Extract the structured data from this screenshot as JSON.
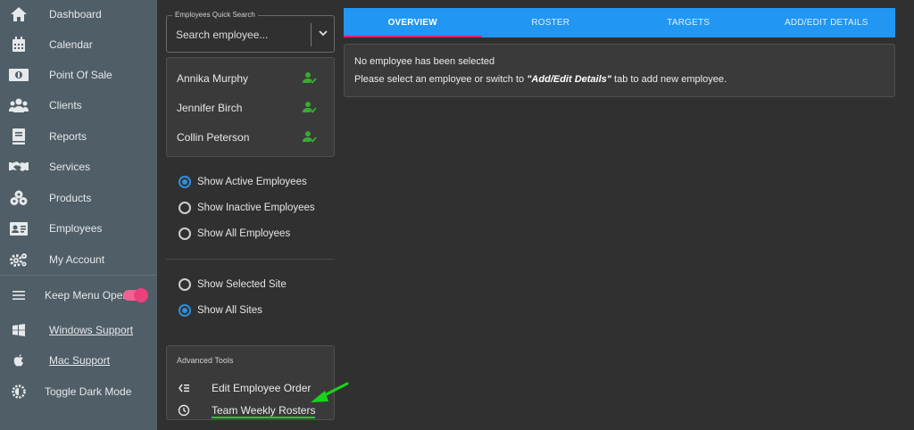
{
  "sidebar": {
    "items": [
      {
        "label": "Dashboard",
        "icon": "home-icon"
      },
      {
        "label": "Calendar",
        "icon": "calendar-icon"
      },
      {
        "label": "Point Of Sale",
        "icon": "cash-icon"
      },
      {
        "label": "Clients",
        "icon": "users-icon"
      },
      {
        "label": "Reports",
        "icon": "book-icon"
      },
      {
        "label": "Services",
        "icon": "handshake-icon"
      },
      {
        "label": "Products",
        "icon": "boxes-icon"
      },
      {
        "label": "Employees",
        "icon": "id-card-icon"
      },
      {
        "label": "My Account",
        "icon": "gears-icon"
      }
    ],
    "keep_menu_open": "Keep Menu Open",
    "windows_support": "Windows Support",
    "mac_support": "Mac Support",
    "toggle_dark_mode": "Toggle Dark Mode"
  },
  "search": {
    "legend": "Employees Quick Search",
    "placeholder": "Search employee..."
  },
  "employees": [
    {
      "name": "Annika Murphy"
    },
    {
      "name": "Jennifer Birch"
    },
    {
      "name": "Collin Peterson"
    }
  ],
  "filters": {
    "active": "Show Active Employees",
    "inactive": "Show Inactive Employees",
    "all": "Show All Employees",
    "selected_site": "Show Selected Site",
    "all_sites": "Show All Sites"
  },
  "advanced": {
    "title": "Advanced Tools",
    "edit_order": "Edit Employee Order",
    "weekly_rosters": "Team Weekly Rosters"
  },
  "tabs": [
    "OVERVIEW",
    "ROSTER",
    "TARGETS",
    "ADD/EDIT DETAILS"
  ],
  "message": {
    "line1": "No employee has been selected",
    "line2_pre": "Please select an employee or switch to ",
    "line2_em": "\"Add/Edit Details\"",
    "line2_post": " tab to add new employee."
  },
  "colors": {
    "sidebar": "#4f5e67",
    "tab_bar": "#2196f3",
    "tab_indicator": "#e91e63",
    "toggle": "#f06292",
    "radio_active": "#2f8fe0",
    "employee_icon": "#3aaa35",
    "annotation_arrow": "#18d418"
  }
}
